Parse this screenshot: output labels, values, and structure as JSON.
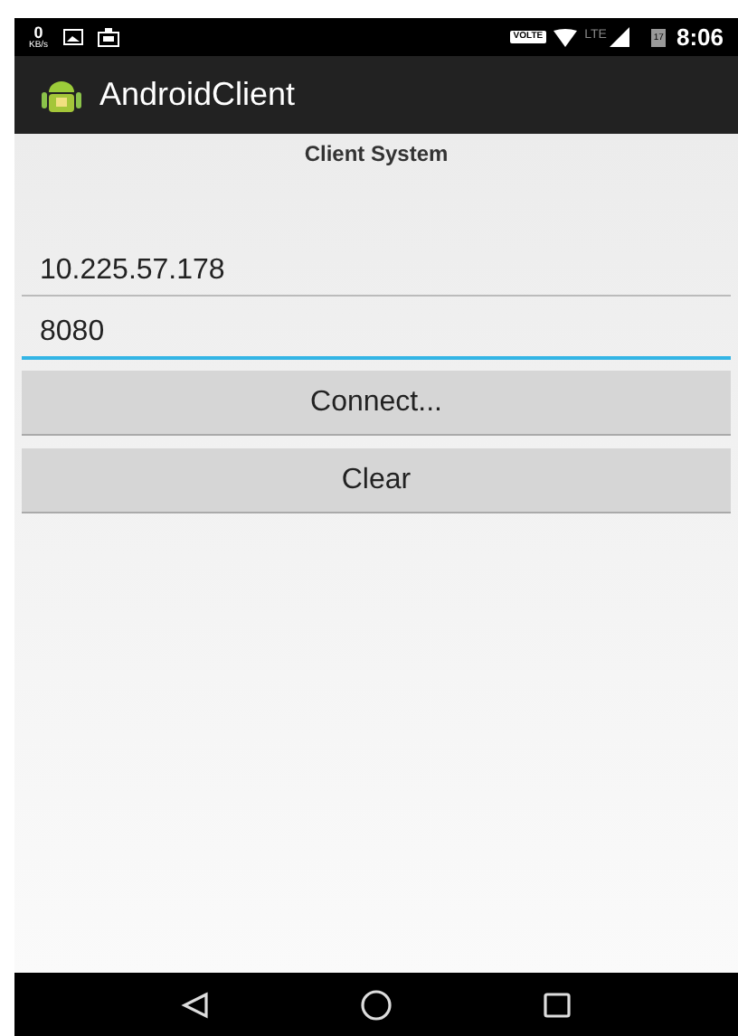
{
  "status_bar": {
    "speed_value": "0",
    "speed_unit": "KB/s",
    "volte_badge": "VOLTE",
    "network": "LTE",
    "battery_level_text": "17",
    "time": "8:06"
  },
  "app_bar": {
    "title": "AndroidClient"
  },
  "heading": "Client System",
  "fields": [
    {
      "value": "10.225.57.178",
      "focused": false
    },
    {
      "value": "8080",
      "focused": true
    }
  ],
  "buttons": [
    "Connect...",
    "Clear"
  ]
}
